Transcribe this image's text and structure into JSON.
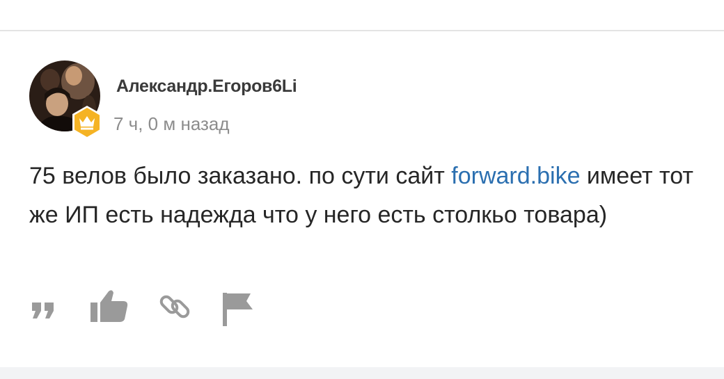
{
  "comment": {
    "author": "Александр.Егоров6Li",
    "time": "7 ч, 0 м назад",
    "body_before_link": "75 велов было заказано. по сути сайт ",
    "link_text": "forward.bike",
    "body_after_link": " имеет тот же ИП есть надежда что у него есть столкьо товара)",
    "badge_icon": "crown-icon",
    "badge_color": "#f5b324"
  },
  "actions": {
    "icons": [
      "quote-icon",
      "like-icon",
      "link-icon",
      "report-flag-icon"
    ],
    "icon_color": "#9a9a9a"
  },
  "colors": {
    "link": "#2b6fb0",
    "text": "#262626",
    "meta": "#8c8c8c"
  }
}
